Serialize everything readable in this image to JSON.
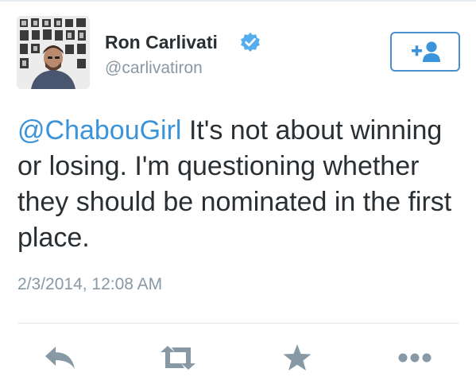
{
  "user": {
    "display_name": "Ron Carlivati",
    "handle": "@carlivatiron",
    "verified": true
  },
  "tweet": {
    "mention": "@ChabouGirl",
    "body": " It's not about winning or losing. I'm questioning whether they should be nominated in the first place.",
    "timestamp": "2/3/2014, 12:08 AM"
  },
  "icons": {
    "follow": "add-user-icon",
    "verified": "verified-badge-icon",
    "reply": "reply-icon",
    "retweet": "retweet-icon",
    "favorite": "star-icon",
    "more": "more-icon"
  },
  "colors": {
    "accent": "#3b94d9",
    "follow_border": "#4a90d0",
    "text": "#292f33",
    "muted": "#8899a6",
    "action_icons": "#8899a6"
  }
}
